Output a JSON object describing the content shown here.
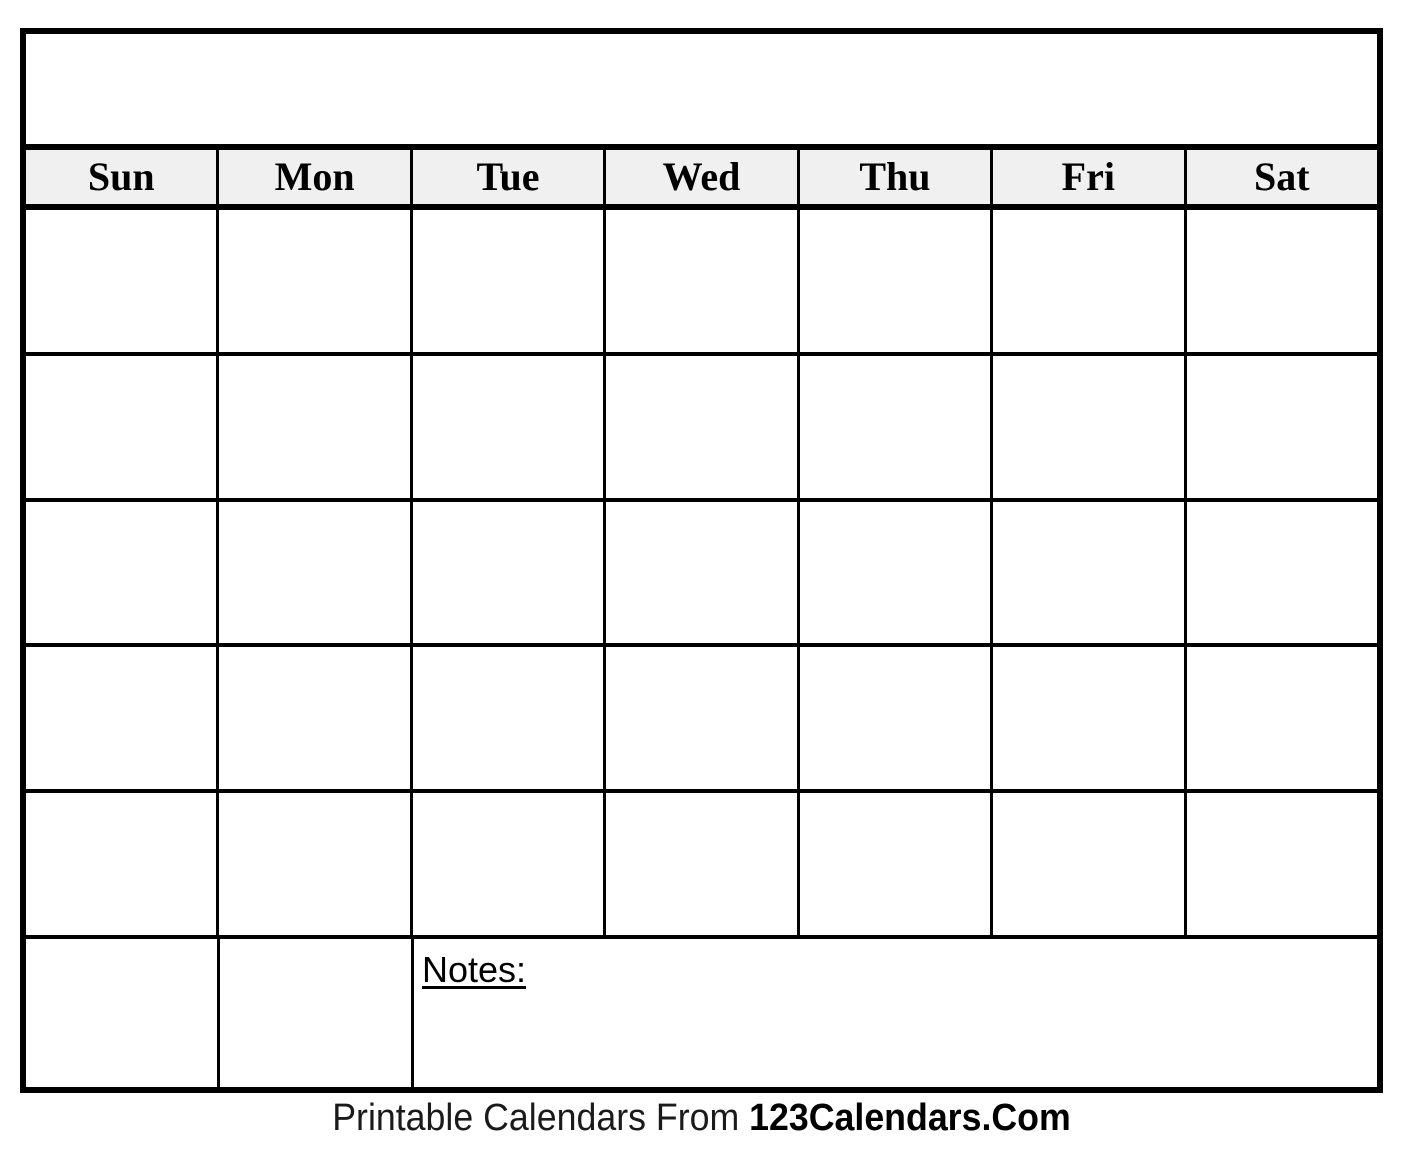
{
  "document": {
    "type": "blank-monthly-calendar-template"
  },
  "title_bar": {
    "value": "",
    "placeholder": ""
  },
  "weekdays": [
    {
      "label": "Sun"
    },
    {
      "label": "Mon"
    },
    {
      "label": "Tue"
    },
    {
      "label": "Wed"
    },
    {
      "label": "Thu"
    },
    {
      "label": "Fri"
    },
    {
      "label": "Sat"
    }
  ],
  "weeks": [
    {
      "days": [
        "",
        "",
        "",
        "",
        "",
        "",
        ""
      ]
    },
    {
      "days": [
        "",
        "",
        "",
        "",
        "",
        "",
        ""
      ]
    },
    {
      "days": [
        "",
        "",
        "",
        "",
        "",
        "",
        ""
      ]
    },
    {
      "days": [
        "",
        "",
        "",
        "",
        "",
        "",
        ""
      ]
    },
    {
      "days": [
        "",
        "",
        "",
        "",
        "",
        "",
        ""
      ]
    }
  ],
  "last_row": {
    "days": [
      "",
      ""
    ],
    "notes_label": "Notes:",
    "notes_value": ""
  },
  "footer": {
    "prefix": "Printable Calendars From ",
    "brand": "123Calendars.Com"
  },
  "colors": {
    "border": "#000000",
    "header_background": "#f0f0f0",
    "page_background": "#ffffff",
    "text": "#000000"
  }
}
